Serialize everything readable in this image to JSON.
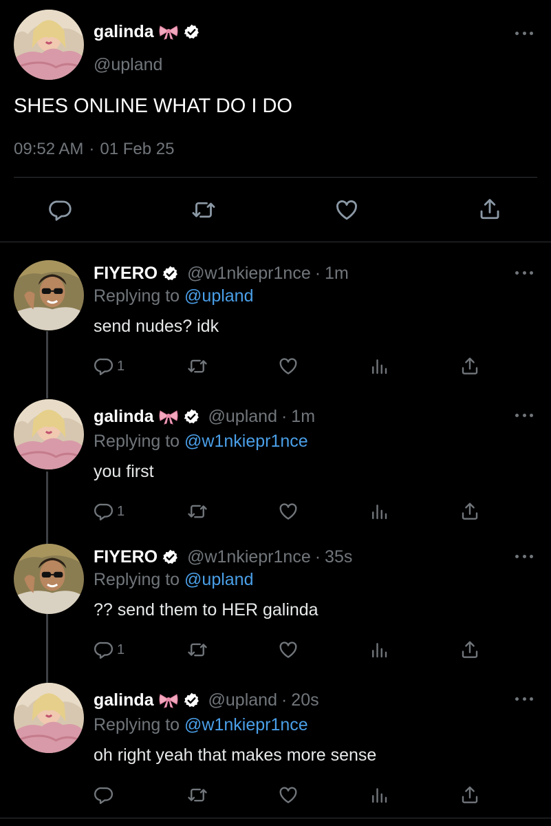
{
  "main": {
    "name": "galinda",
    "handle": "@upland",
    "text": "SHES ONLINE WHAT DO I DO",
    "time": "09:52 AM",
    "sep": "·",
    "date": "01 Feb 25"
  },
  "replies": [
    {
      "name": "FIYERO",
      "handle": "@w1nkiepr1nce",
      "sep": "·",
      "age": "1m",
      "replying_prefix": "Replying to",
      "replying_to": "@upland",
      "text": "send nudes? idk",
      "reply_count": "1"
    },
    {
      "name": "galinda",
      "handle": "@upland",
      "sep": "·",
      "age": "1m",
      "replying_prefix": "Replying to",
      "replying_to": "@w1nkiepr1nce",
      "text": "you first",
      "reply_count": "1"
    },
    {
      "name": "FIYERO",
      "handle": "@w1nkiepr1nce",
      "sep": "·",
      "age": "35s",
      "replying_prefix": "Replying to",
      "replying_to": "@upland",
      "text": "?? send them to HER galinda",
      "reply_count": "1"
    },
    {
      "name": "galinda",
      "handle": "@upland",
      "sep": "·",
      "age": "20s",
      "replying_prefix": "Replying to",
      "replying_to": "@w1nkiepr1nce",
      "text": "oh right yeah that makes more sense",
      "reply_count": ""
    }
  ],
  "icons": {
    "reply": "reply-icon",
    "retweet": "retweet-icon",
    "like": "heart-icon",
    "views": "views-icon",
    "share": "share-icon",
    "verified": "verified-badge-icon",
    "bow": "ribbon-bow-icon",
    "more": "more-dots-icon"
  },
  "colors": {
    "background": "#000000",
    "text": "#e7e9ea",
    "muted": "#71767b",
    "link": "#4a9fe8",
    "divider": "#2f3336"
  }
}
